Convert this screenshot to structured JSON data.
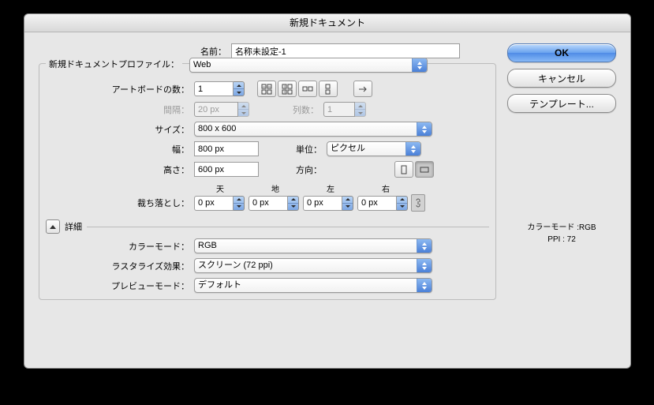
{
  "title": "新規ドキュメント",
  "labels": {
    "name": "名前：",
    "profile": "新規ドキュメントプロファイル：",
    "artboards": "アートボードの数：",
    "spacing": "間隔：",
    "cols": "列数：",
    "size": "サイズ：",
    "width": "幅：",
    "units": "単位：",
    "height": "高さ：",
    "orient": "方向：",
    "bleed": "裁ち落とし：",
    "top": "天",
    "bottom": "地",
    "left": "左",
    "right": "右",
    "advanced": "詳細",
    "colormode": "カラーモード：",
    "raster": "ラスタライズ効果：",
    "preview": "プレビューモード："
  },
  "values": {
    "name": "名称未設定-1",
    "profile": "Web",
    "artboards": "1",
    "spacing": "20 px",
    "cols": "1",
    "size": "800 x 600",
    "width": "800 px",
    "units": "ピクセル",
    "height": "600 px",
    "bleed_top": "0 px",
    "bleed_bottom": "0 px",
    "bleed_left": "0 px",
    "bleed_right": "0 px",
    "colormode": "RGB",
    "raster": "スクリーン (72 ppi)",
    "preview": "デフォルト"
  },
  "buttons": {
    "ok": "OK",
    "cancel": "キャンセル",
    "template": "テンプレート..."
  },
  "info": {
    "colormode": "カラーモード :RGB",
    "ppi": "PPI : 72"
  }
}
